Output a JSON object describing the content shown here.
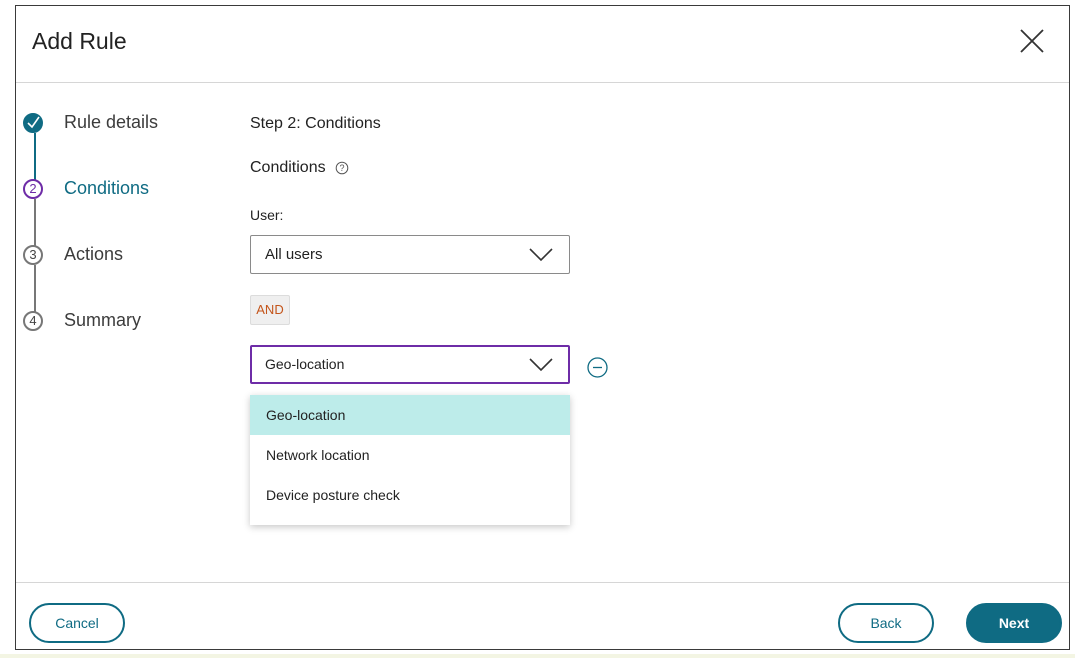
{
  "dialog": {
    "title": "Add Rule"
  },
  "stepper": {
    "steps": [
      {
        "number": "",
        "label": "Rule details",
        "state": "complete"
      },
      {
        "number": "2",
        "label": "Conditions",
        "state": "active"
      },
      {
        "number": "3",
        "label": "Actions",
        "state": "pending"
      },
      {
        "number": "4",
        "label": "Summary",
        "state": "pending"
      }
    ]
  },
  "main": {
    "step_heading": "Step 2: Conditions",
    "conditions_heading": "Conditions",
    "user_label": "User:",
    "user_select_value": "All users",
    "operator_badge": "AND",
    "condition_select_value": "Geo-location",
    "dropdown_options": [
      "Geo-location",
      "Network location",
      "Device posture check"
    ],
    "selected_option": "Geo-location"
  },
  "footer": {
    "cancel_label": "Cancel",
    "back_label": "Back",
    "next_label": "Next"
  },
  "colors": {
    "accent": "#0f6b83",
    "focus": "#6e2ca7",
    "operator": "#c4551b",
    "selected_row": "#bdecea"
  },
  "icons": [
    "close-icon",
    "check-icon",
    "help-icon",
    "chevron-down-icon",
    "remove-condition-icon"
  ]
}
